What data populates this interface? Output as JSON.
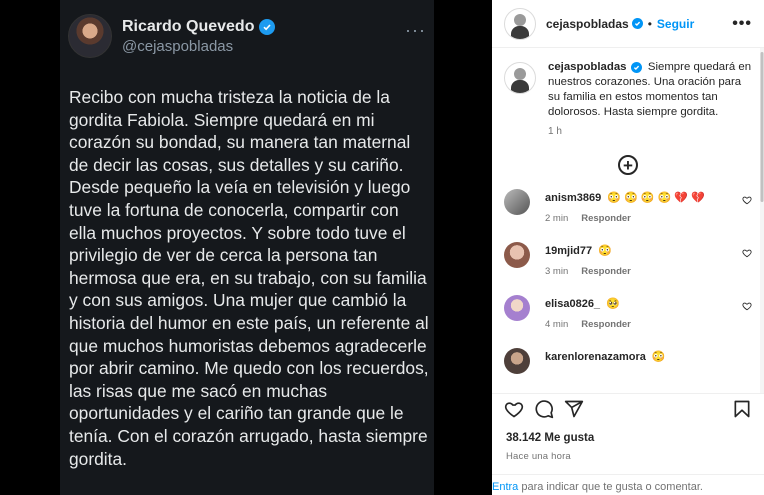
{
  "tweet": {
    "name": "Ricardo Quevedo",
    "handle": "@cejaspobladas",
    "text": "Recibo con mucha tristeza la noticia de la gordita Fabiola. Siempre quedará en mi corazón su bondad, su manera tan maternal de decir las cosas, sus detalles y su cariño. Desde pequeño la veía en televisión y luego tuve la fortuna de conocerla, compartir con ella muchos proyectos. Y sobre todo tuve el privilegio de ver de cerca la persona tan hermosa que era, en su trabajo, con su familia y con sus amigos. Una mujer que cambió la historia del humor en este país, un referente al que muchos humoristas debemos agradecerle por abrir camino. Me quedo con los recuerdos, las risas que me sacó en muchas oportunidades y el cariño tan grande que le tenía. Con el corazón arrugado, hasta siempre gordita."
  },
  "header": {
    "username": "cejaspobladas",
    "separator": "•",
    "follow": "Seguir",
    "more": "•••"
  },
  "caption": {
    "username": "cejaspobladas",
    "text": "Siempre quedará en nuestros corazones. Una oración para su familia en estos momentos tan dolorosos. Hasta siempre gordita.",
    "time": "1 h"
  },
  "load_more": "+",
  "comments": [
    {
      "user": "anism3869",
      "text": "😳 😳 😳 😳 💔 💔",
      "time": "2 min",
      "reply": "Responder",
      "avatar_color": "#8a8a8a"
    },
    {
      "user": "19mjid77",
      "text": "😳",
      "time": "3 min",
      "reply": "Responder",
      "avatar_color": "#c79a8a"
    },
    {
      "user": "elisa0826_",
      "text": "🥺",
      "time": "4 min",
      "reply": "Responder",
      "avatar_color": "#b89bd6"
    },
    {
      "user": "karenlorenazamora",
      "text": "😳",
      "time": "",
      "reply": "",
      "avatar_color": "#6a5d58"
    }
  ],
  "actions": {
    "likes": "38.142 Me gusta",
    "time_ago": "Hace una hora"
  },
  "footer": {
    "link": "Entra",
    "text": " para indicar que te gusta o comentar."
  },
  "colors": {
    "accent": "#0095f6",
    "tweet_bg": "#15181c",
    "verified_twitter": "#1d9bf0"
  }
}
